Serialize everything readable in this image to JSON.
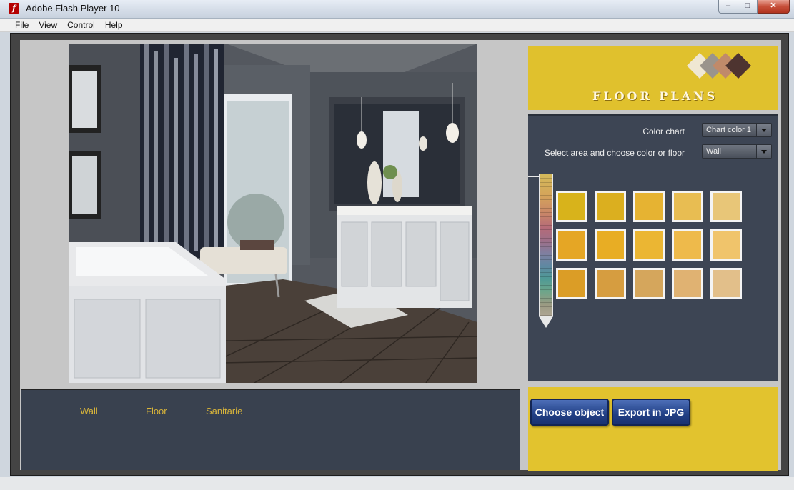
{
  "window": {
    "title": "Adobe Flash Player 10",
    "minimize_glyph": "–",
    "maximize_glyph": "□",
    "close_glyph": "✕"
  },
  "menu": [
    "File",
    "View",
    "Control",
    "Help"
  ],
  "app": {
    "logo_text": "FLOOR PLANS",
    "logo_diamond_colors": [
      "#efe7d3",
      "#9a948c",
      "#c08a6a",
      "#4e3430"
    ],
    "color_chart": {
      "label": "Color chart",
      "selected": "Chart color 1"
    },
    "area_select": {
      "label": "Select area and choose color or floor",
      "selected": "Wall"
    },
    "swatches": [
      [
        "#d8b31b",
        "#dbaf1f",
        "#e6b332",
        "#e8bd52",
        "#e8c678"
      ],
      [
        "#e5a625",
        "#e8ad24",
        "#ebb633",
        "#eeba4b",
        "#f0c46b"
      ],
      [
        "#db9d26",
        "#d69d40",
        "#d5a65c",
        "#e0b272",
        "#e2bf8a"
      ]
    ],
    "areas": [
      "Wall",
      "Floor",
      "Sanitarie"
    ],
    "buttons": {
      "choose_object": "Choose object",
      "export": "Export in JPG"
    }
  }
}
